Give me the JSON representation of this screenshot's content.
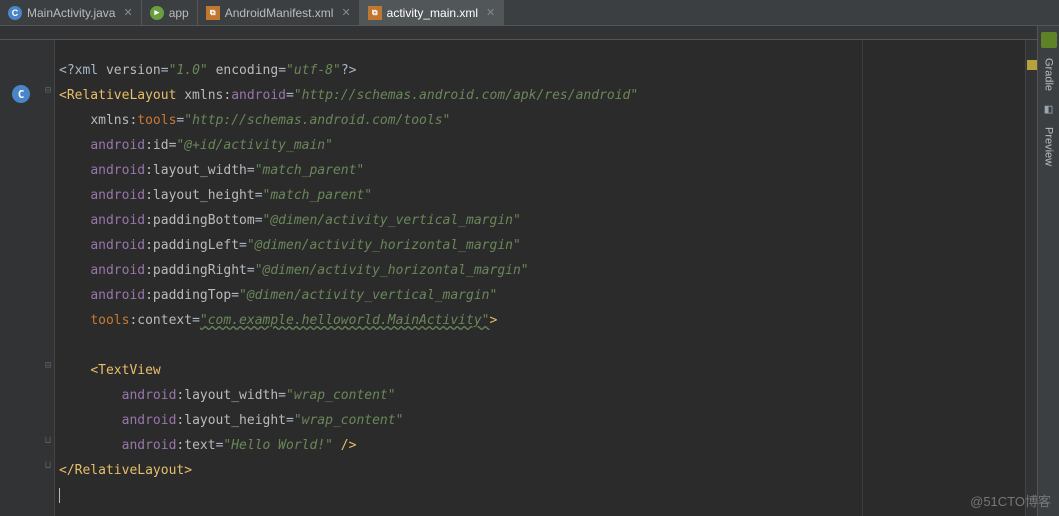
{
  "tabs": [
    {
      "label": "MainActivity.java",
      "icon": "c-icon",
      "active": false,
      "closeable": true
    },
    {
      "label": "app",
      "icon": "green-icon",
      "active": false,
      "closeable": false
    },
    {
      "label": "AndroidManifest.xml",
      "icon": "xml-icon",
      "active": false,
      "closeable": true
    },
    {
      "label": "activity_main.xml",
      "icon": "xml-icon",
      "active": true,
      "closeable": true
    }
  ],
  "gutter": {
    "class_indicator": "C"
  },
  "side_tools": {
    "gradle": "Gradle",
    "preview": "Preview"
  },
  "code": {
    "pi_open": "<?",
    "pi_name": "xml",
    "pi_version_k": "version",
    "pi_version_v": "\"1.0\"",
    "pi_encoding_k": "encoding",
    "pi_encoding_v": "\"utf-8\"",
    "pi_close": "?>",
    "root_open": "<",
    "root_tag": "RelativeLayout",
    "attr_xmlns": "xmlns:",
    "ns_android": "android",
    "ns_tools": "tools",
    "eq": "=",
    "v_ns_android": "\"http://schemas.android.com/apk/res/android\"",
    "v_ns_tools": "\"http://schemas.android.com/tools\"",
    "k_id": ":id",
    "v_id": "\"@+id/activity_main\"",
    "k_lw": ":layout_width",
    "v_lw": "\"match_parent\"",
    "k_lh": ":layout_height",
    "v_lh": "\"match_parent\"",
    "k_pb": ":paddingBottom",
    "v_pb": "\"@dimen/activity_vertical_margin\"",
    "k_pl": ":paddingLeft",
    "v_pl": "\"@dimen/activity_horizontal_margin\"",
    "k_pr": ":paddingRight",
    "v_pr": "\"@dimen/activity_horizontal_margin\"",
    "k_pt": ":paddingTop",
    "v_pt": "\"@dimen/activity_vertical_margin\"",
    "k_ctx": ":context",
    "v_ctx": "\"com.example.helloworld.MainActivity\"",
    "close_angle": ">",
    "tv_open": "<",
    "tv_tag": "TextView",
    "tv_lw_v": "\"wrap_content\"",
    "tv_lh_v": "\"wrap_content\"",
    "k_text": ":text",
    "v_text": "\"Hello World!\"",
    "self_close": " />",
    "root_close_open": "</",
    "root_close_tag": "RelativeLayout",
    "root_close": ">"
  },
  "watermark": "@51CTO博客"
}
